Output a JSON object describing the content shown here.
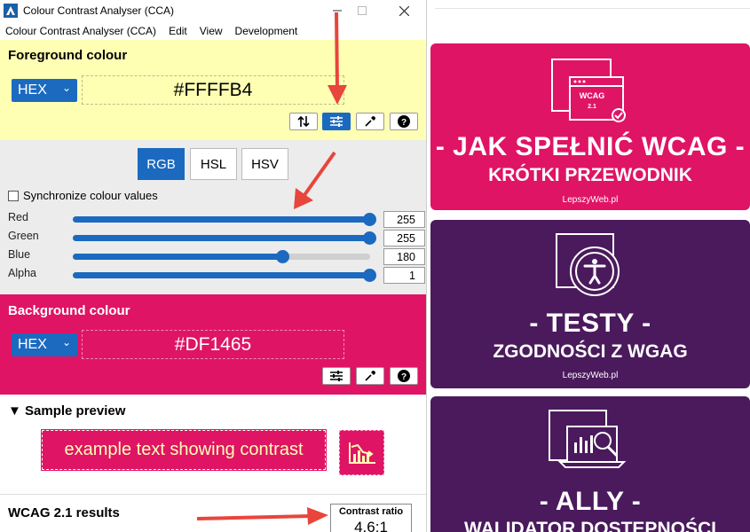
{
  "window": {
    "title": "Colour Contrast Analyser (CCA)",
    "minimize_glyph": "—",
    "maximize_glyph": "☐",
    "close_glyph": "✕"
  },
  "menu": [
    "Colour Contrast Analyser (CCA)",
    "Edit",
    "View",
    "Development"
  ],
  "foreground": {
    "title": "Foreground colour",
    "format": "HEX",
    "hex": "#FFFFB4",
    "color": "#FFFFB4"
  },
  "modes": [
    "RGB",
    "HSL",
    "HSV"
  ],
  "active_mode": "RGB",
  "sync_label": "Synchronize colour values",
  "channels": [
    {
      "label": "Red",
      "value": "255",
      "fraction": 1.0
    },
    {
      "label": "Green",
      "value": "255",
      "fraction": 1.0
    },
    {
      "label": "Blue",
      "value": "180",
      "fraction": 0.706
    },
    {
      "label": "Alpha",
      "value": "1",
      "fraction": 1.0
    }
  ],
  "background": {
    "title": "Background colour",
    "format": "HEX",
    "hex": "#DF1465",
    "color": "#DF1465"
  },
  "sample": {
    "title": "Sample preview",
    "text": "example text showing contrast"
  },
  "results": {
    "title": "WCAG 2.1 results",
    "ratio_label": "Contrast ratio",
    "ratio_value": "4.6:1"
  },
  "banners": [
    {
      "heading": "- JAK SPEŁNIĆ WCAG -",
      "sub": "KRÓTKI PRZEWODNIK",
      "brand": "LepszyWeb.pl",
      "icon_text1": "WCAG",
      "icon_text2": "2.1",
      "color": "#DF1465",
      "icon": "wcag-window-icon"
    },
    {
      "heading": "- TESTY -",
      "sub": "ZGODNOŚCI Z WGAG",
      "brand": "LepszyWeb.pl",
      "color": "#4A1A5C",
      "icon": "accessibility-icon"
    },
    {
      "heading": "- ALLY -",
      "sub": "WALIDATOR DOSTĘPNOŚCI",
      "brand": "",
      "color": "#4A1A5C",
      "icon": "laptop-chart-icon"
    }
  ],
  "colors": {
    "accent": "#1B6AC0",
    "arrow": "#E8453C"
  }
}
